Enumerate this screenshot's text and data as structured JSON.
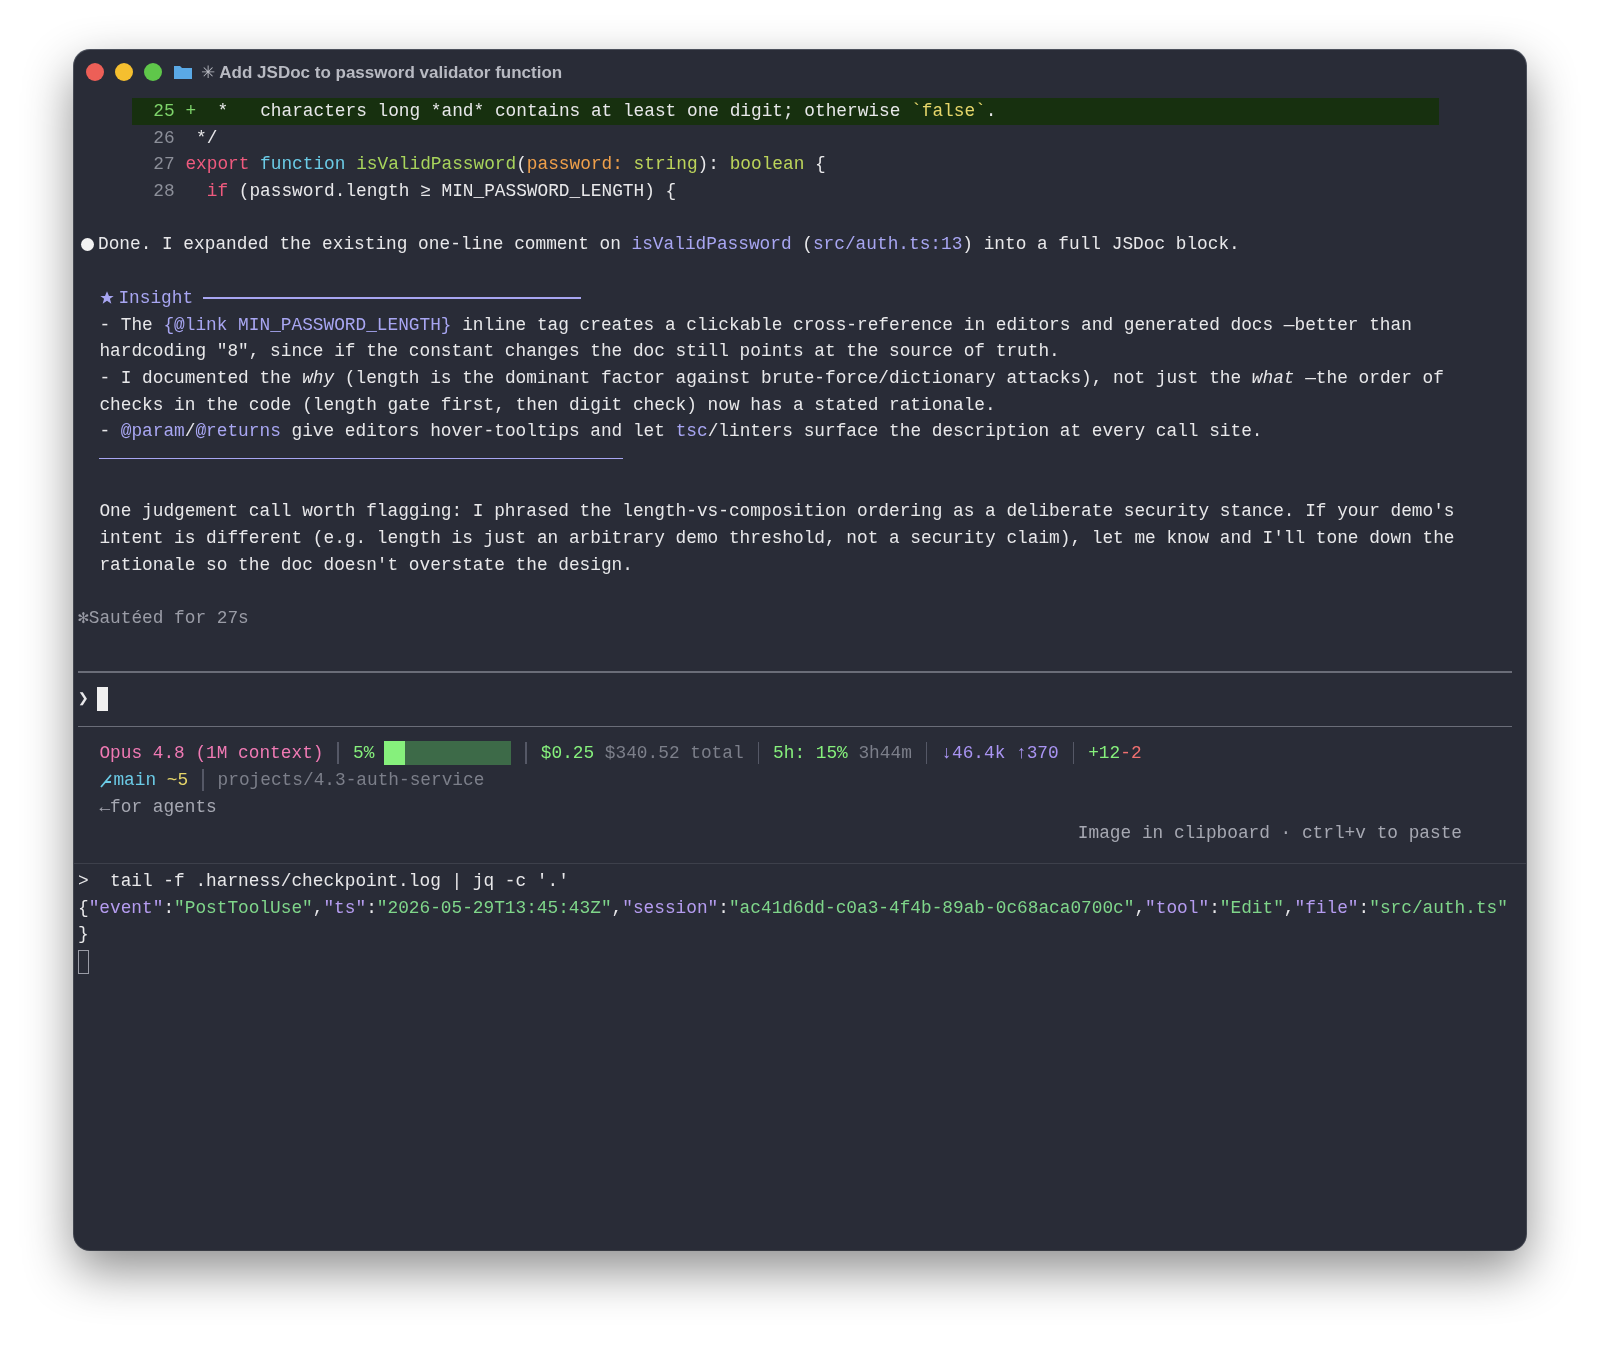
{
  "window": {
    "title_glyph": "✳",
    "title": "Add JSDoc to password validator function"
  },
  "diff_lines": [
    {
      "number": "25",
      "marker": "+",
      "added": true,
      "tokens": [
        {
          "kind": "plain",
          "text": "*   characters long *and* contains at least one digit; otherwise "
        },
        {
          "kind": "string",
          "text": "`false`"
        },
        {
          "kind": "plain",
          "text": "."
        }
      ]
    },
    {
      "number": "26",
      "added": false,
      "tokens": [
        {
          "kind": "plain",
          "text": " */"
        }
      ]
    },
    {
      "number": "27",
      "added": false,
      "tokens": [
        {
          "kind": "keyword",
          "text": "export "
        },
        {
          "kind": "storage",
          "text": "function "
        },
        {
          "kind": "func",
          "text": "isValidPassword"
        },
        {
          "kind": "plain",
          "text": "("
        },
        {
          "kind": "param",
          "text": "password: "
        },
        {
          "kind": "type",
          "text": "string"
        },
        {
          "kind": "plain",
          "text": "): "
        },
        {
          "kind": "type",
          "text": "boolean"
        },
        {
          "kind": "plain",
          "text": " {"
        }
      ]
    },
    {
      "number": "28",
      "added": false,
      "tokens": [
        {
          "kind": "keyword",
          "text": "  if"
        },
        {
          "kind": "plain",
          "text": " (password.length ≥ MIN_PASSWORD_LENGTH) {"
        }
      ]
    }
  ],
  "message": {
    "segments": [
      {
        "kind": "plain",
        "text": "Done. I expanded the existing one-line comment on "
      },
      {
        "kind": "ref",
        "text": "isValidPassword"
      },
      {
        "kind": "plain",
        "text": " ("
      },
      {
        "kind": "ref",
        "text": "src/auth.ts:13"
      },
      {
        "kind": "plain",
        "text": ") into a full JSDoc block."
      }
    ]
  },
  "insight": {
    "title": "Insight",
    "lines": [
      [
        {
          "kind": "plain",
          "text": "- The "
        },
        {
          "kind": "ref",
          "text": "{@link MIN_PASSWORD_LENGTH}"
        },
        {
          "kind": "plain",
          "text": " inline tag creates a clickable cross-reference in editors and generated docs —better than"
        }
      ],
      [
        {
          "kind": "plain",
          "text": "hardcoding \"8\", since if the constant changes the doc still points at the source of truth."
        }
      ],
      [
        {
          "kind": "plain",
          "text": "- I documented the *why* (length is the dominant factor against brute-force/dictionary attacks), not just the *what* —the order of"
        }
      ],
      [
        {
          "kind": "plain",
          "text": "checks in the code (length gate first, then digit check) now has a stated rationale."
        }
      ],
      [
        {
          "kind": "plain",
          "text": "- "
        },
        {
          "kind": "ref",
          "text": "@param"
        },
        {
          "kind": "plain",
          "text": "/"
        },
        {
          "kind": "ref",
          "text": "@returns"
        },
        {
          "kind": "plain",
          "text": " give editors hover-tooltips and let "
        },
        {
          "kind": "ref",
          "text": "tsc"
        },
        {
          "kind": "plain",
          "text": "/linters surface the description at every call site."
        }
      ]
    ]
  },
  "paragraph": [
    "One judgement call worth flagging: I phrased the length-vs-composition ordering as a deliberate security stance. If your demo's",
    "intent is different (e.g. length is just an arbitrary demo threshold, not a security claim), let me know and I'll tone down the",
    "rationale so the doc doesn't overstate the design."
  ],
  "status": {
    "glyph": "✻",
    "text": "Sautéed for 27s"
  },
  "prompt": {
    "glyph": "❯"
  },
  "statusline": {
    "model": "Opus 4.8 (1M context)",
    "context_percent": "5%",
    "context_meter": {
      "level": 0.16
    },
    "cost": "$0.25",
    "total": "$340.52 total",
    "usage": "5h: 15%",
    "reset": "3h44m",
    "tokens_in": "↓46.4k",
    "tokens_out": "↑370",
    "lines_added": "+12",
    "lines_removed": "-2",
    "branch": "main",
    "dirty": "~5",
    "path": "projects/4.3-auth-service",
    "mode": "←for agents",
    "hint": "Image in clipboard · ctrl+v to paste"
  },
  "terminal": {
    "prompt": ">",
    "command": "tail -f .harness/checkpoint.log | jq -c '.'",
    "output": [
      [
        {
          "kind": "punct",
          "text": "{"
        },
        {
          "kind": "key",
          "text": "\"event\""
        },
        {
          "kind": "punct",
          "text": ":"
        },
        {
          "kind": "str",
          "text": "\"PostToolUse\""
        },
        {
          "kind": "punct",
          "text": ","
        },
        {
          "kind": "key",
          "text": "\"ts\""
        },
        {
          "kind": "punct",
          "text": ":"
        },
        {
          "kind": "str",
          "text": "\"2026-05-29T13:45:43Z\""
        },
        {
          "kind": "punct",
          "text": ","
        },
        {
          "kind": "key",
          "text": "\"session\""
        },
        {
          "kind": "punct",
          "text": ":"
        },
        {
          "kind": "str",
          "text": "\"ac41d6dd-c0a3-4f4b-89ab-0c68aca0700c\""
        },
        {
          "kind": "punct",
          "text": ","
        },
        {
          "kind": "key",
          "text": "\"tool\""
        },
        {
          "kind": "punct",
          "text": ":"
        },
        {
          "kind": "str",
          "text": "\"Edit\""
        },
        {
          "kind": "punct",
          "text": ","
        },
        {
          "kind": "key",
          "text": "\"file\""
        },
        {
          "kind": "punct",
          "text": ":"
        },
        {
          "kind": "str",
          "text": "\"src/auth.ts\""
        }
      ],
      [
        {
          "kind": "punct",
          "text": "}"
        }
      ]
    ]
  }
}
